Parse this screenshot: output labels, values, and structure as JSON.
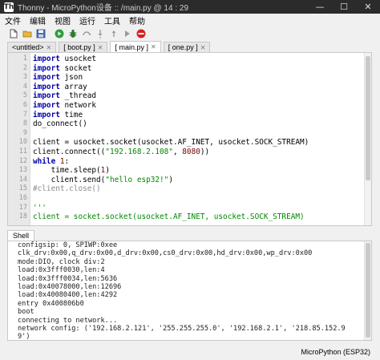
{
  "window": {
    "app_icon": "Th",
    "title": "Thonny  -  MicroPython设备 :: /main.py  @  14 : 29",
    "controls": {
      "minimize": "—",
      "maximize": "☐",
      "close": "✕"
    }
  },
  "menubar": {
    "items": [
      "文件",
      "编辑",
      "视图",
      "运行",
      "工具",
      "帮助"
    ]
  },
  "toolbar": {
    "icons": [
      "new-file-icon",
      "open-file-icon",
      "save-icon",
      "run-icon",
      "debug-icon",
      "step-over-icon",
      "step-into-icon",
      "step-out-icon",
      "resume-icon",
      "stop-icon"
    ],
    "colors": {
      "run": "#2e9e3a",
      "stop": "#d52020",
      "debug": "#2e7d32",
      "disabled": "#9a9a9a"
    }
  },
  "tabs": [
    {
      "label": "<untitled>",
      "active": false
    },
    {
      "label": "[ boot.py ]",
      "active": false
    },
    {
      "label": "[ main.py ]",
      "active": true
    },
    {
      "label": "[ one.py ]",
      "active": false
    }
  ],
  "editor": {
    "line_numbers": [
      "1",
      "2",
      "3",
      "4",
      "5",
      "6",
      "7",
      "8",
      "9",
      "10",
      "11",
      "12",
      "13",
      "14",
      "15",
      "16",
      "17",
      "18"
    ],
    "lines": [
      [
        {
          "t": "import",
          "c": "kw"
        },
        {
          "t": " usocket",
          "c": ""
        }
      ],
      [
        {
          "t": "import",
          "c": "kw"
        },
        {
          "t": " socket",
          "c": ""
        }
      ],
      [
        {
          "t": "import",
          "c": "kw"
        },
        {
          "t": " json",
          "c": ""
        }
      ],
      [
        {
          "t": "import",
          "c": "kw"
        },
        {
          "t": " array",
          "c": ""
        }
      ],
      [
        {
          "t": "import",
          "c": "kw"
        },
        {
          "t": " _thread",
          "c": ""
        }
      ],
      [
        {
          "t": "import",
          "c": "kw"
        },
        {
          "t": " network",
          "c": ""
        }
      ],
      [
        {
          "t": "import",
          "c": "kw"
        },
        {
          "t": " time",
          "c": ""
        }
      ],
      [
        {
          "t": "do_connect()",
          "c": ""
        }
      ],
      [
        {
          "t": "",
          "c": ""
        }
      ],
      [
        {
          "t": "client = usocket.socket(usocket.AF_INET, usocket.SOCK_STREAM)",
          "c": ""
        }
      ],
      [
        {
          "t": "client.connect((",
          "c": ""
        },
        {
          "t": "\"192.168.2.108\"",
          "c": "str"
        },
        {
          "t": ", ",
          "c": ""
        },
        {
          "t": "8080",
          "c": "num"
        },
        {
          "t": "))",
          "c": ""
        }
      ],
      [
        {
          "t": "while",
          "c": "kw"
        },
        {
          "t": " ",
          "c": ""
        },
        {
          "t": "1",
          "c": "num"
        },
        {
          "t": ":",
          "c": ""
        }
      ],
      [
        {
          "t": "    time.sleep(",
          "c": ""
        },
        {
          "t": "1",
          "c": "num"
        },
        {
          "t": ")",
          "c": ""
        }
      ],
      [
        {
          "t": "    client.send(",
          "c": ""
        },
        {
          "t": "\"hello esp32!\"",
          "c": "str"
        },
        {
          "t": ")",
          "c": ""
        }
      ],
      [
        {
          "t": "#client.close()",
          "c": "cmt"
        }
      ],
      [
        {
          "t": "",
          "c": ""
        }
      ],
      [
        {
          "t": "'''",
          "c": "str"
        }
      ],
      [
        {
          "t": "client = socket.socket(usocket.AF_INET, usocket.SOCK_STREAM)",
          "c": "str"
        }
      ]
    ]
  },
  "shell": {
    "tab_label": "Shell",
    "lines": [
      "configsip: 0, SPIWP:0xee",
      "clk_drv:0x00,q_drv:0x00,d_drv:0x00,cs0_drv:0x00,hd_drv:0x00,wp_drv:0x00",
      "mode:DIO, clock div:2",
      "load:0x3fff0030,len:4",
      "load:0x3fff0034,len:5636",
      "load:0x40078000,len:12696",
      "load:0x40080400,len:4292",
      "entry 0x400806b0",
      "boot",
      "connecting to network...",
      "network config: ('192.168.2.121', '255.255.255.0', '192.168.2.1', '218.85.152.9",
      "9')"
    ]
  },
  "statusbar": {
    "interpreter": "MicroPython (ESP32)"
  }
}
